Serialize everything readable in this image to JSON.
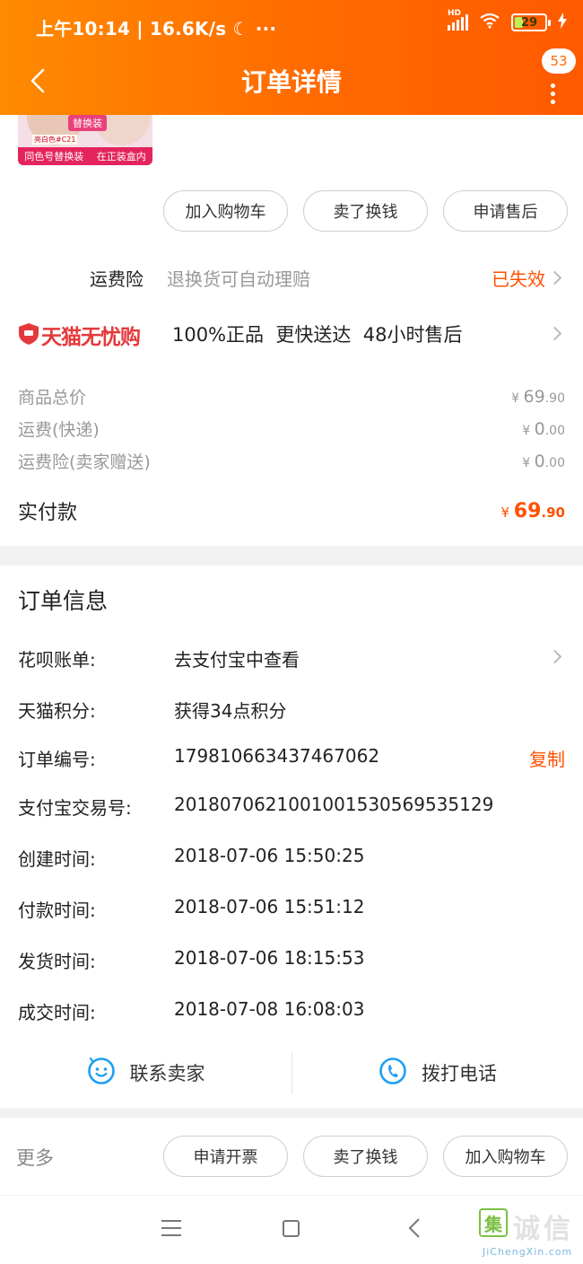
{
  "status_bar": {
    "left_text": "上午10:14 | 16.6K/s ☾ ···",
    "network_label": "HD",
    "battery": "29",
    "battery_level": 0.29
  },
  "nav": {
    "title": "订单详情",
    "badge_count": "53"
  },
  "product_thumb": {
    "tag": "替换装",
    "small_text": "亮白色#C21",
    "bottom_left": "同色号替换装",
    "bottom_right": "在正装盒内"
  },
  "item_actions": [
    "加入购物车",
    "卖了换钱",
    "申请售后"
  ],
  "insurance": {
    "label": "运费险",
    "desc": "退换货可自动理赔",
    "status": "已失效"
  },
  "tmall": {
    "brand": "天猫无忧购",
    "features": "100%正品  更快送达  48小时售后"
  },
  "price": {
    "rows": [
      {
        "label": "商品总价",
        "currency": "¥",
        "int": "69",
        "dec": ".90"
      },
      {
        "label": "运费(快递)",
        "currency": "¥",
        "int": "0",
        "dec": ".00"
      },
      {
        "label": "运费险(卖家赠送)",
        "currency": "¥",
        "int": "0",
        "dec": ".00"
      }
    ],
    "paid_label": "实付款",
    "paid_currency": "¥",
    "paid_int": "69",
    "paid_dec": ".90"
  },
  "order_info": {
    "title": "订单信息",
    "rows": [
      {
        "label": "花呗账单:",
        "value": "去支付宝中查看"
      },
      {
        "label": "天猫积分:",
        "value": "获得34点积分"
      },
      {
        "label": "订单编号:",
        "value": "179810663437467062"
      },
      {
        "label": "支付宝交易号:",
        "value": "2018070621001001530569535129"
      },
      {
        "label": "创建时间:",
        "value": "2018-07-06 15:50:25"
      },
      {
        "label": "付款时间:",
        "value": "2018-07-06 15:51:12"
      },
      {
        "label": "发货时间:",
        "value": "2018-07-06 18:15:53"
      },
      {
        "label": "成交时间:",
        "value": "2018-07-08 16:08:03"
      }
    ],
    "copy_label": "复制"
  },
  "contact": {
    "seller": "联系卖家",
    "phone": "拨打电话"
  },
  "bottom_actions": {
    "more": "更多",
    "buttons": [
      "申请开票",
      "卖了换钱",
      "加入购物车"
    ]
  },
  "watermark": {
    "logo_char": "集",
    "text": "诚信",
    "url": "JiChengXin.com"
  },
  "colors": {
    "accent": "#ff6a00",
    "price_orange": "#ff5000",
    "tmall_red": "#e4393c",
    "contact_blue": "#1e9ff2"
  }
}
